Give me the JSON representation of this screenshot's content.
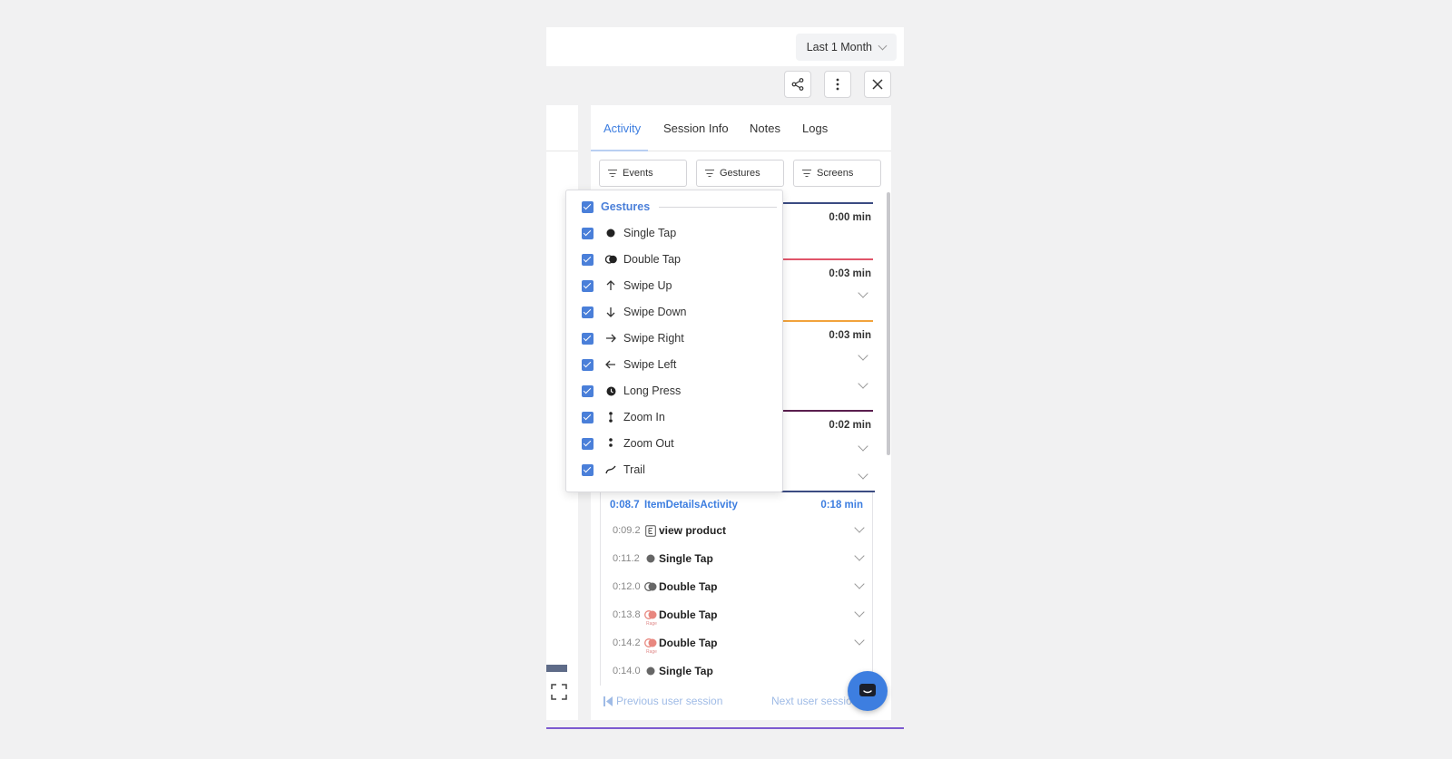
{
  "header": {
    "range_label": "Last 1 Month"
  },
  "toolbar": {
    "share_icon": "share-icon",
    "more_icon": "more-vertical-icon",
    "close_icon": "close-icon"
  },
  "tabs": [
    {
      "label": "Activity",
      "active": true
    },
    {
      "label": "Session Info"
    },
    {
      "label": "Notes"
    },
    {
      "label": "Logs"
    }
  ],
  "filters": [
    {
      "label": "Events"
    },
    {
      "label": "Gestures"
    },
    {
      "label": "Screens"
    }
  ],
  "timeline": {
    "groups": [
      {
        "duration": "0:00 min",
        "color": "#3b4b82"
      },
      {
        "duration": "0:03 min",
        "color": "#e0556a"
      },
      {
        "duration": "0:03 min",
        "color": "#f2a33c"
      },
      {
        "duration": "0:02 min",
        "color": "#5a1e4e"
      }
    ],
    "expanded_group": {
      "time": "0:08.7",
      "name": "ItemDetailsActivity",
      "duration": "0:18 min",
      "events": [
        {
          "time": "0:09.2",
          "label": "view product",
          "icon": "event-icon"
        },
        {
          "time": "0:11.2",
          "label": "Single Tap",
          "icon": "single-tap-icon"
        },
        {
          "time": "0:12.0",
          "label": "Double Tap",
          "icon": "double-tap-icon"
        },
        {
          "time": "0:13.8",
          "label": "Double Tap",
          "icon": "rage-double-tap-icon",
          "tag": "Rage"
        },
        {
          "time": "0:14.2",
          "label": "Double Tap",
          "icon": "rage-double-tap-icon",
          "tag": "Rage"
        },
        {
          "time": "0:14.0",
          "label": "Single Tap",
          "icon": "single-tap-icon"
        }
      ]
    }
  },
  "navigation": {
    "prev_label": "Previous user session",
    "next_label": "Next user session"
  },
  "gesture_filter": {
    "header": "Gestures",
    "items": [
      {
        "label": "Single Tap",
        "icon": "single-tap-icon"
      },
      {
        "label": "Double Tap",
        "icon": "double-tap-icon"
      },
      {
        "label": "Swipe Up",
        "icon": "arrow-up-icon"
      },
      {
        "label": "Swipe Down",
        "icon": "arrow-down-icon"
      },
      {
        "label": "Swipe Right",
        "icon": "arrow-right-icon"
      },
      {
        "label": "Swipe Left",
        "icon": "arrow-left-icon"
      },
      {
        "label": "Long Press",
        "icon": "long-press-icon"
      },
      {
        "label": "Zoom In",
        "icon": "zoom-in-icon"
      },
      {
        "label": "Zoom Out",
        "icon": "zoom-out-icon"
      },
      {
        "label": "Trail",
        "icon": "trail-icon"
      }
    ]
  },
  "colors": {
    "accent": "#3d7ee0",
    "checkbox": "#4a7fd9",
    "session_bar": "#7d5bd0"
  }
}
